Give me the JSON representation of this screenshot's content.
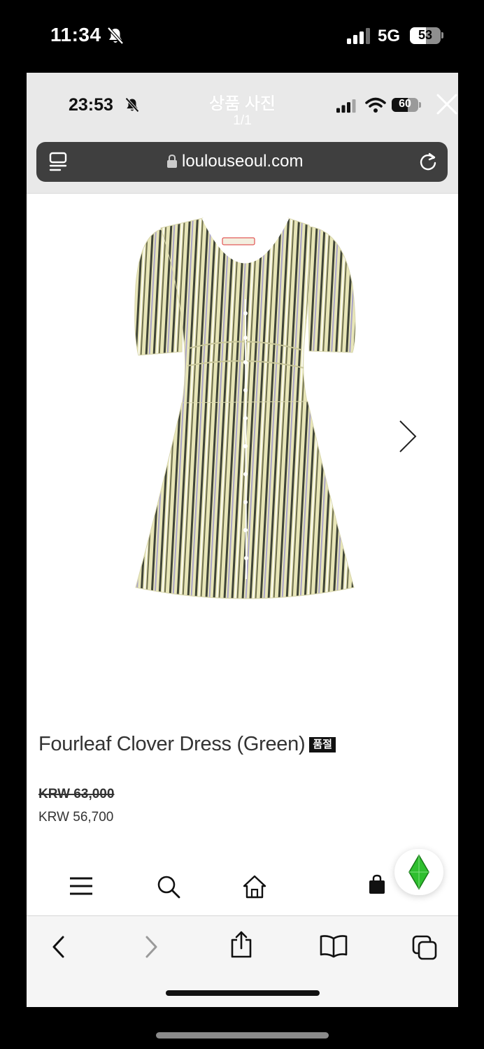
{
  "outer_status": {
    "time": "11:34",
    "network": "5G",
    "battery": 53,
    "icons": [
      "bell-slash-icon",
      "cellular-signal-icon",
      "battery-icon"
    ]
  },
  "inner_status": {
    "time": "23:53",
    "battery": 60,
    "icons": [
      "bell-slash-icon",
      "cellular-signal-icon",
      "wifi-icon",
      "battery-icon"
    ]
  },
  "viewer": {
    "title": "상품 사진",
    "counter": "1/1",
    "close_icon": "close-icon"
  },
  "browser": {
    "url": "loulouseoul.com",
    "left_icon": "page-menu-icon",
    "lock_icon": "lock-icon",
    "reload_icon": "reload-icon"
  },
  "product": {
    "image_icon": "striped-dress-image",
    "next_icon": "chevron-right-icon",
    "name": "Fourleaf Clover Dress (Green)",
    "badge": "품절",
    "price_original": "KRW 63,000",
    "price_sale": "KRW 56,700"
  },
  "site_nav": {
    "items": [
      "menu-icon",
      "search-icon",
      "home-icon",
      "shopping-bag-icon"
    ],
    "floating_icon": "green-diamond-icon"
  },
  "browser_toolbar": {
    "items": [
      "back-icon",
      "forward-icon",
      "share-icon",
      "bookmarks-icon",
      "tabs-icon"
    ]
  },
  "colors": {
    "header_bg": "#e9e9e9",
    "url_bar_bg": "#3f3f3f",
    "dress_base": "#e8e6b8",
    "dress_stripe_dark": "#3f4437",
    "dress_stripe_lilac": "#a9a3c8",
    "badge_bg": "#111111",
    "floating_icon": "#2fbf2f"
  }
}
